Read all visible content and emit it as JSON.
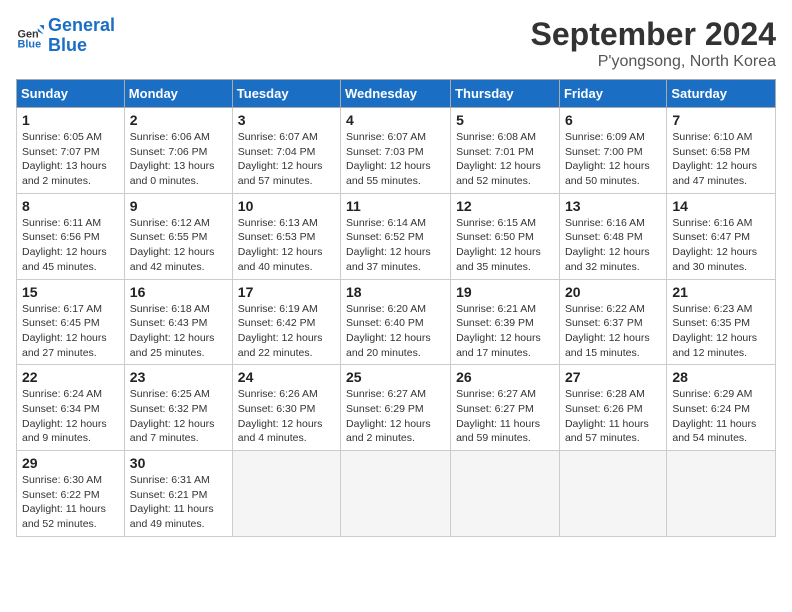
{
  "header": {
    "logo_line1": "General",
    "logo_line2": "Blue",
    "month": "September 2024",
    "location": "P'yongsong, North Korea"
  },
  "weekdays": [
    "Sunday",
    "Monday",
    "Tuesday",
    "Wednesday",
    "Thursday",
    "Friday",
    "Saturday"
  ],
  "weeks": [
    [
      {
        "day": "1",
        "info": "Sunrise: 6:05 AM\nSunset: 7:07 PM\nDaylight: 13 hours\nand 2 minutes."
      },
      {
        "day": "2",
        "info": "Sunrise: 6:06 AM\nSunset: 7:06 PM\nDaylight: 13 hours\nand 0 minutes."
      },
      {
        "day": "3",
        "info": "Sunrise: 6:07 AM\nSunset: 7:04 PM\nDaylight: 12 hours\nand 57 minutes."
      },
      {
        "day": "4",
        "info": "Sunrise: 6:07 AM\nSunset: 7:03 PM\nDaylight: 12 hours\nand 55 minutes."
      },
      {
        "day": "5",
        "info": "Sunrise: 6:08 AM\nSunset: 7:01 PM\nDaylight: 12 hours\nand 52 minutes."
      },
      {
        "day": "6",
        "info": "Sunrise: 6:09 AM\nSunset: 7:00 PM\nDaylight: 12 hours\nand 50 minutes."
      },
      {
        "day": "7",
        "info": "Sunrise: 6:10 AM\nSunset: 6:58 PM\nDaylight: 12 hours\nand 47 minutes."
      }
    ],
    [
      {
        "day": "8",
        "info": "Sunrise: 6:11 AM\nSunset: 6:56 PM\nDaylight: 12 hours\nand 45 minutes."
      },
      {
        "day": "9",
        "info": "Sunrise: 6:12 AM\nSunset: 6:55 PM\nDaylight: 12 hours\nand 42 minutes."
      },
      {
        "day": "10",
        "info": "Sunrise: 6:13 AM\nSunset: 6:53 PM\nDaylight: 12 hours\nand 40 minutes."
      },
      {
        "day": "11",
        "info": "Sunrise: 6:14 AM\nSunset: 6:52 PM\nDaylight: 12 hours\nand 37 minutes."
      },
      {
        "day": "12",
        "info": "Sunrise: 6:15 AM\nSunset: 6:50 PM\nDaylight: 12 hours\nand 35 minutes."
      },
      {
        "day": "13",
        "info": "Sunrise: 6:16 AM\nSunset: 6:48 PM\nDaylight: 12 hours\nand 32 minutes."
      },
      {
        "day": "14",
        "info": "Sunrise: 6:16 AM\nSunset: 6:47 PM\nDaylight: 12 hours\nand 30 minutes."
      }
    ],
    [
      {
        "day": "15",
        "info": "Sunrise: 6:17 AM\nSunset: 6:45 PM\nDaylight: 12 hours\nand 27 minutes."
      },
      {
        "day": "16",
        "info": "Sunrise: 6:18 AM\nSunset: 6:43 PM\nDaylight: 12 hours\nand 25 minutes."
      },
      {
        "day": "17",
        "info": "Sunrise: 6:19 AM\nSunset: 6:42 PM\nDaylight: 12 hours\nand 22 minutes."
      },
      {
        "day": "18",
        "info": "Sunrise: 6:20 AM\nSunset: 6:40 PM\nDaylight: 12 hours\nand 20 minutes."
      },
      {
        "day": "19",
        "info": "Sunrise: 6:21 AM\nSunset: 6:39 PM\nDaylight: 12 hours\nand 17 minutes."
      },
      {
        "day": "20",
        "info": "Sunrise: 6:22 AM\nSunset: 6:37 PM\nDaylight: 12 hours\nand 15 minutes."
      },
      {
        "day": "21",
        "info": "Sunrise: 6:23 AM\nSunset: 6:35 PM\nDaylight: 12 hours\nand 12 minutes."
      }
    ],
    [
      {
        "day": "22",
        "info": "Sunrise: 6:24 AM\nSunset: 6:34 PM\nDaylight: 12 hours\nand 9 minutes."
      },
      {
        "day": "23",
        "info": "Sunrise: 6:25 AM\nSunset: 6:32 PM\nDaylight: 12 hours\nand 7 minutes."
      },
      {
        "day": "24",
        "info": "Sunrise: 6:26 AM\nSunset: 6:30 PM\nDaylight: 12 hours\nand 4 minutes."
      },
      {
        "day": "25",
        "info": "Sunrise: 6:27 AM\nSunset: 6:29 PM\nDaylight: 12 hours\nand 2 minutes."
      },
      {
        "day": "26",
        "info": "Sunrise: 6:27 AM\nSunset: 6:27 PM\nDaylight: 11 hours\nand 59 minutes."
      },
      {
        "day": "27",
        "info": "Sunrise: 6:28 AM\nSunset: 6:26 PM\nDaylight: 11 hours\nand 57 minutes."
      },
      {
        "day": "28",
        "info": "Sunrise: 6:29 AM\nSunset: 6:24 PM\nDaylight: 11 hours\nand 54 minutes."
      }
    ],
    [
      {
        "day": "29",
        "info": "Sunrise: 6:30 AM\nSunset: 6:22 PM\nDaylight: 11 hours\nand 52 minutes."
      },
      {
        "day": "30",
        "info": "Sunrise: 6:31 AM\nSunset: 6:21 PM\nDaylight: 11 hours\nand 49 minutes."
      },
      {
        "day": "",
        "info": ""
      },
      {
        "day": "",
        "info": ""
      },
      {
        "day": "",
        "info": ""
      },
      {
        "day": "",
        "info": ""
      },
      {
        "day": "",
        "info": ""
      }
    ]
  ]
}
